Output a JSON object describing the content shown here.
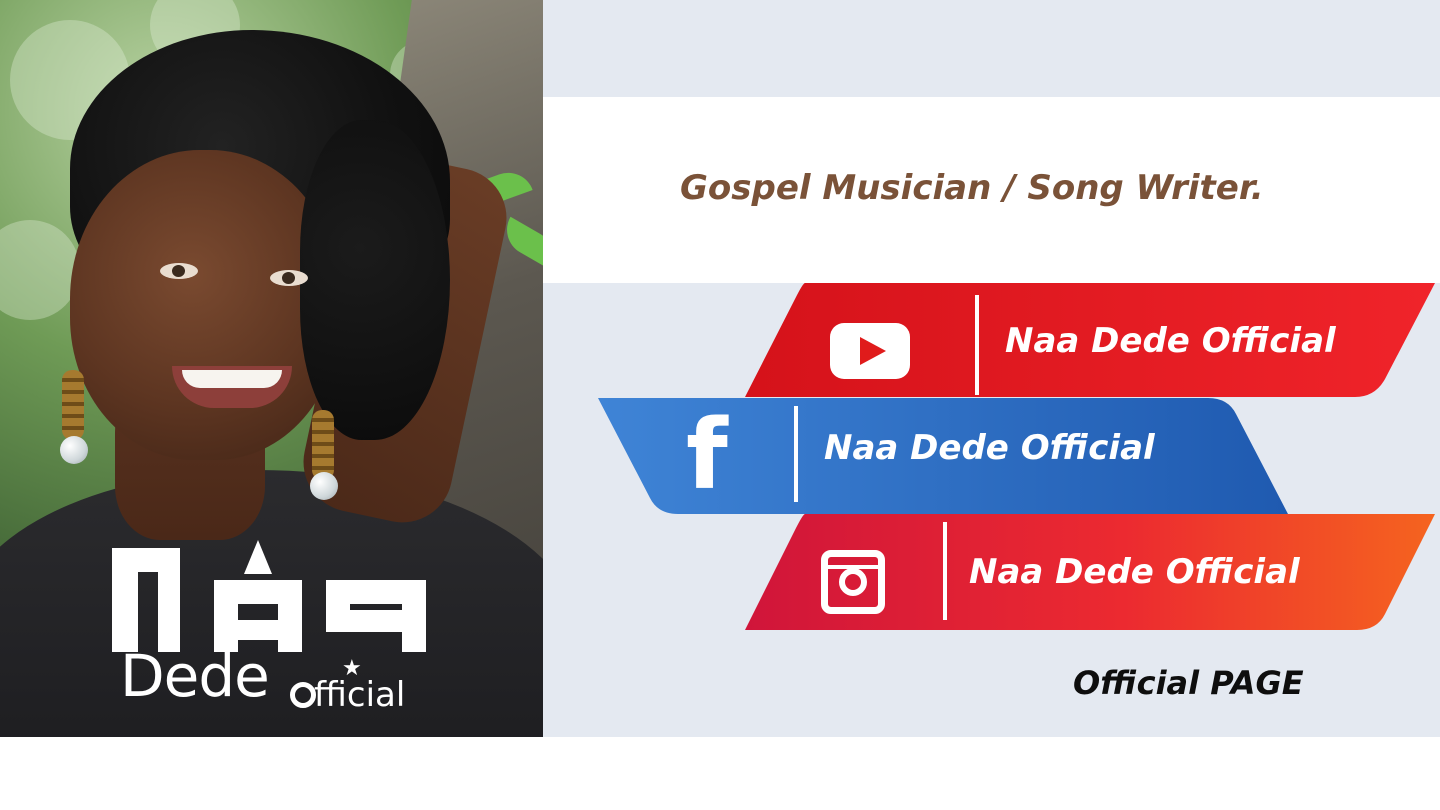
{
  "tagline": "Gospel Musician / Song Writer.",
  "logo": {
    "line1": "NAA",
    "line2": "Dede",
    "line3": "fficial"
  },
  "social": [
    {
      "platform": "youtube",
      "icon": "youtube-icon",
      "label": "Naa Dede Official",
      "color": "#e01b1b"
    },
    {
      "platform": "facebook",
      "icon": "facebook-icon",
      "label": "Naa Dede Official",
      "color": "#2f6fc0"
    },
    {
      "platform": "instagram",
      "icon": "instagram-icon",
      "label": "Naa Dede Official",
      "color": "#e8283a"
    }
  ],
  "footer_label": "Official PAGE"
}
